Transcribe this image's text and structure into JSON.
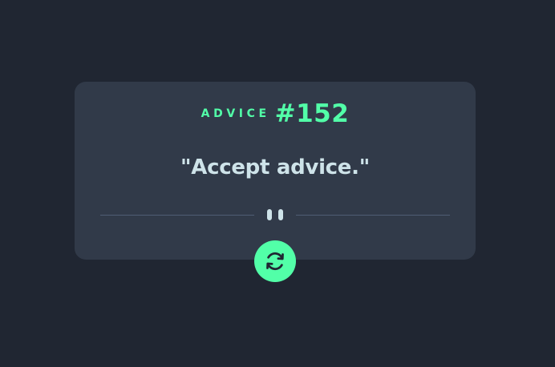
{
  "advice": {
    "label": "ADVICE",
    "number": "#152",
    "quote": "\"Accept advice.\""
  },
  "colors": {
    "background": "#202632",
    "card": "#313a49",
    "accent": "#52ffa8",
    "text": "#cee3e9",
    "divider": "#4f5d74"
  },
  "icons": {
    "divider": "pause-icon",
    "button": "refresh-icon"
  }
}
